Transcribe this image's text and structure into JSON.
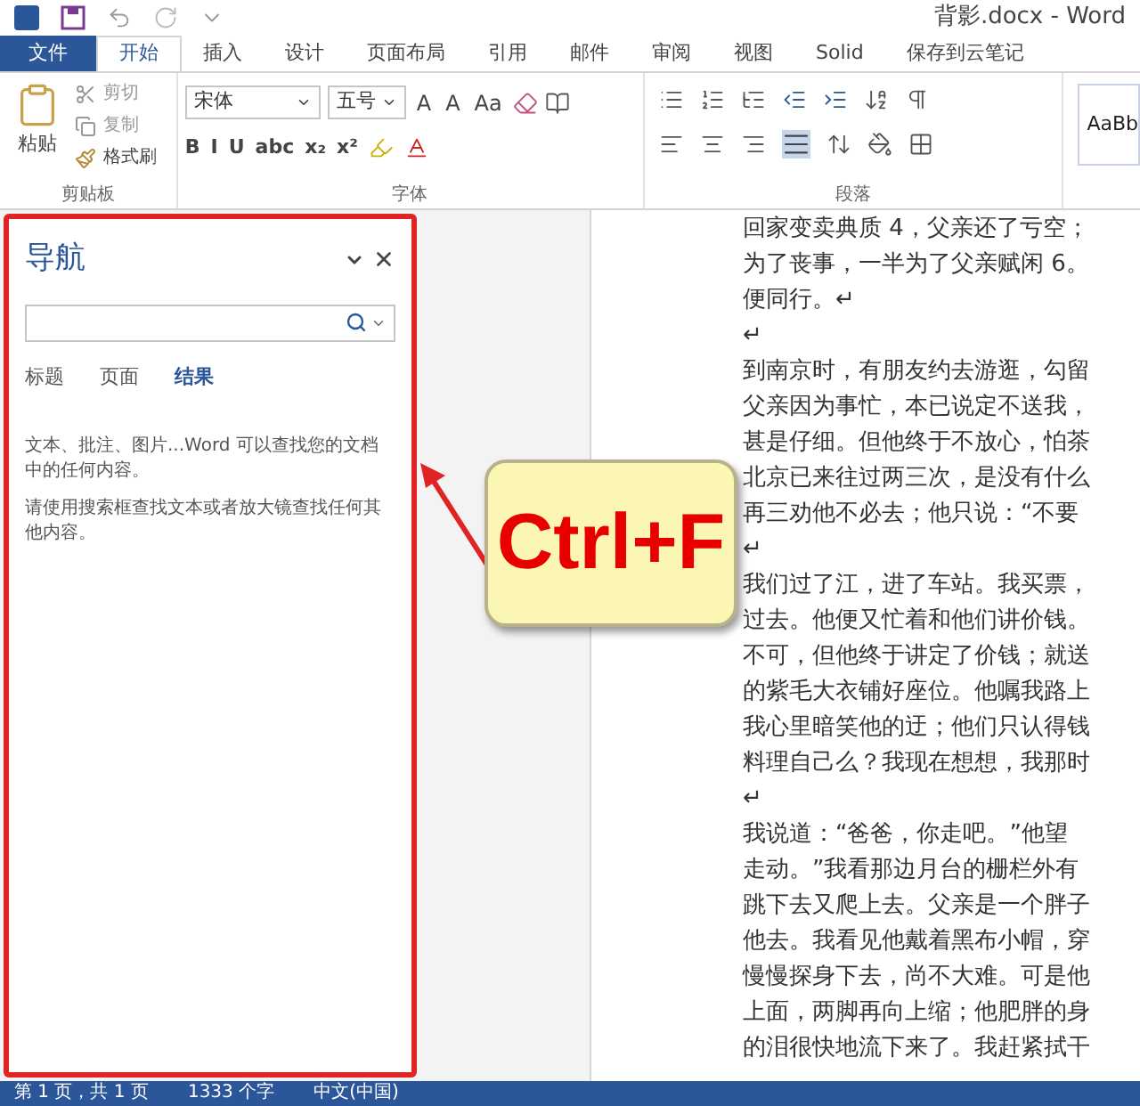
{
  "window": {
    "title": "背影.docx - Word"
  },
  "ribbon_tabs": [
    {
      "label": "文件",
      "kind": "file",
      "selected": false
    },
    {
      "label": "开始",
      "kind": "tab",
      "selected": true
    },
    {
      "label": "插入",
      "kind": "tab",
      "selected": false
    },
    {
      "label": "设计",
      "kind": "tab",
      "selected": false
    },
    {
      "label": "页面布局",
      "kind": "tab",
      "selected": false
    },
    {
      "label": "引用",
      "kind": "tab",
      "selected": false
    },
    {
      "label": "邮件",
      "kind": "tab",
      "selected": false
    },
    {
      "label": "审阅",
      "kind": "tab",
      "selected": false
    },
    {
      "label": "视图",
      "kind": "tab",
      "selected": false
    },
    {
      "label": "Solid",
      "kind": "tab",
      "selected": false
    },
    {
      "label": "保存到云笔记",
      "kind": "tab",
      "selected": false
    }
  ],
  "clipboard": {
    "label": "剪贴板",
    "paste": "粘贴",
    "cut": "剪切",
    "copy": "复制",
    "format_painter": "格式刷"
  },
  "font": {
    "label": "字体",
    "font_name": "宋体",
    "font_size": "五号",
    "size_buttons": [
      "A",
      "A",
      "Aa"
    ],
    "format_buttons": [
      "B",
      "I",
      "U",
      "abc",
      "x₂",
      "x²"
    ]
  },
  "paragraph": {
    "label": "段落"
  },
  "styles": {
    "preview": "AaBb"
  },
  "navigation": {
    "title": "导航",
    "tabs": [
      {
        "label": "标题",
        "selected": false
      },
      {
        "label": "页面",
        "selected": false
      },
      {
        "label": "结果",
        "selected": true
      }
    ],
    "messages": [
      "文本、批注、图片...Word 可以查找您的文档中的任何内容。",
      "请使用搜索框查找文本或者放大镜查找任何其他内容。"
    ]
  },
  "callout": {
    "text": "Ctrl+F"
  },
  "document": {
    "lines": [
      "回家变卖典质 4，父亲还了亏空；",
      "为了丧事，一半为了父亲赋闲 6。",
      "便同行。↵",
      "↵",
      "到南京时，有朋友约去游逛，勾留",
      "父亲因为事忙，本已说定不送我，",
      "甚是仔细。但他终于不放心，怕茶",
      "北京已来往过两三次，是没有什么",
      "再三劝他不必去；他只说：“不要",
      "↵",
      "我们过了江，进了车站。我买票，",
      "过去。他便又忙着和他们讲价钱。",
      "不可，但他终于讲定了价钱；就送",
      "的紫毛大衣铺好座位。他嘱我路上",
      "我心里暗笑他的迂；他们只认得钱",
      "料理自己么？我现在想想，我那时",
      "↵",
      "我说道：“爸爸，你走吧。”他望",
      "走动。”我看那边月台的栅栏外有",
      "跳下去又爬上去。父亲是一个胖子",
      "他去。我看见他戴着黑布小帽，穿",
      "慢慢探身下去，尚不大难。可是他",
      "上面，两脚再向上缩；他肥胖的身",
      "的泪很快地流下来了。我赶紧拭干"
    ]
  },
  "status_bar": [
    "第 1 页，共 1 页",
    "1333 个字",
    "中文(中国)"
  ]
}
